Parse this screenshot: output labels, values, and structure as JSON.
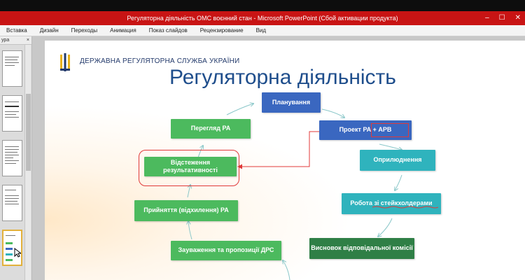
{
  "window": {
    "title": "Регуляторна діяльність ОМС  воєнний стан  -  Microsoft PowerPoint (Сбой активации продукта)",
    "controls": [
      "–",
      "☐",
      "✕"
    ]
  },
  "ribbon": {
    "tabs": [
      "Вставка",
      "Дизайн",
      "Переходы",
      "Анимация",
      "Показ слайдов",
      "Рецензирование",
      "Вид"
    ]
  },
  "pane": {
    "label": "ура",
    "close": "×"
  },
  "slide": {
    "org": "ДЕРЖАВНА РЕГУЛЯТОРНА СЛУЖБА УКРАЇНИ",
    "heading": "Регуляторна діяльність",
    "nodes": {
      "planning": "Планування",
      "project": "Проект РА + АРВ",
      "publish": "Оприлюднення",
      "stakeholders": "Робота зі стейкхолдерами",
      "conclusion": "Висновок відповідальної комісії",
      "remarks": "Зауваження та пропозиції ДРС",
      "adoption": "Прийняття (відхилення) РА",
      "tracking": "Відстеження результативності",
      "review": "Перегляд РА"
    }
  },
  "colors": {
    "titlebar": "#c81414",
    "blue": "#3a67c0",
    "teal": "#2fb3bd",
    "green": "#4cba5e",
    "darkgreen": "#2f7f46",
    "heading": "#1f4e8c",
    "annotation": "#e03a3a"
  }
}
